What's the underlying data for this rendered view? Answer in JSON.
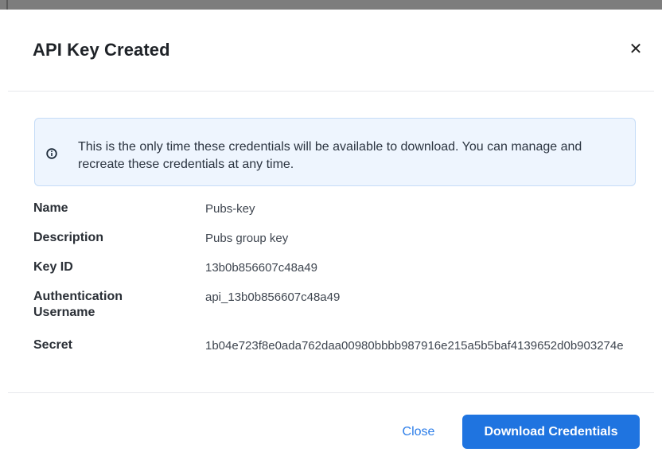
{
  "dialog": {
    "title": "API Key Created",
    "close_icon": "close-icon"
  },
  "notice": {
    "icon": "info-icon",
    "text": "This is the only time these credentials will be available to download. You can manage and recreate these credentials at any time."
  },
  "details": [
    {
      "label": "Name",
      "value": "Pubs-key"
    },
    {
      "label": "Description",
      "value": "Pubs group key"
    },
    {
      "label": "Key ID",
      "value": "13b0b856607c48a49"
    },
    {
      "label": "Authentication Username",
      "value": "api_13b0b856607c48a49"
    },
    {
      "label": "Secret",
      "value": "1b04e723f8e0ada762daa00980bbbb987916e215a5b5baf4139652d0b903274e"
    }
  ],
  "footer": {
    "close_label": "Close",
    "download_label": "Download Credentials"
  },
  "colors": {
    "accent": "#1f74e0",
    "link": "#2b7de9",
    "notice_bg": "#eef5fe",
    "notice_border": "#c5dcf7"
  }
}
